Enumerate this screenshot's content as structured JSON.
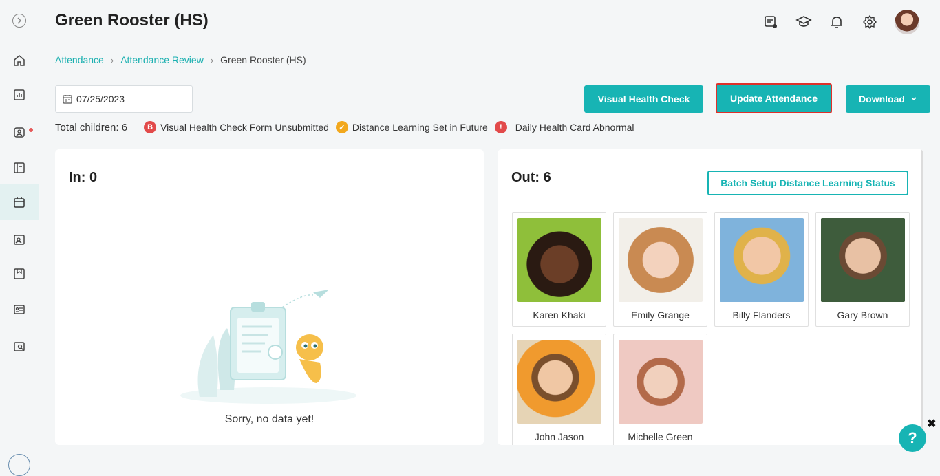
{
  "header": {
    "title": "Green Rooster (HS)"
  },
  "breadcrumb": {
    "items": [
      "Attendance",
      "Attendance Review"
    ],
    "current": "Green Rooster (HS)"
  },
  "toolbar": {
    "date": "07/25/2023",
    "visual_health_check": "Visual Health Check",
    "update_attendance": "Update Attendance",
    "download": "Download"
  },
  "legend": {
    "total": "Total children: 6",
    "items": [
      {
        "label": "Visual Health Check Form Unsubmitted",
        "color": "#e24a4a",
        "icon": "form-unsubmitted-icon"
      },
      {
        "label": "Distance Learning Set in Future",
        "color": "#f2a81d",
        "icon": "check-circle-icon"
      },
      {
        "label": "Daily Health Card Abnormal",
        "color": "#e24a4a",
        "icon": "exclamation-icon"
      }
    ]
  },
  "panel_in": {
    "heading": "In: 0",
    "empty_text": "Sorry, no data yet!"
  },
  "panel_out": {
    "heading": "Out: 6",
    "batch_button": "Batch Setup Distance Learning Status",
    "children": [
      {
        "name": "Karen Khaki"
      },
      {
        "name": "Emily Grange"
      },
      {
        "name": "Billy Flanders"
      },
      {
        "name": "Gary Brown"
      },
      {
        "name": "John Jason"
      },
      {
        "name": "Michelle Green"
      }
    ]
  },
  "colors": {
    "accent": "#17b4b4",
    "highlight_border": "#e0302a"
  },
  "help": {
    "label": "?",
    "close": "✖"
  }
}
